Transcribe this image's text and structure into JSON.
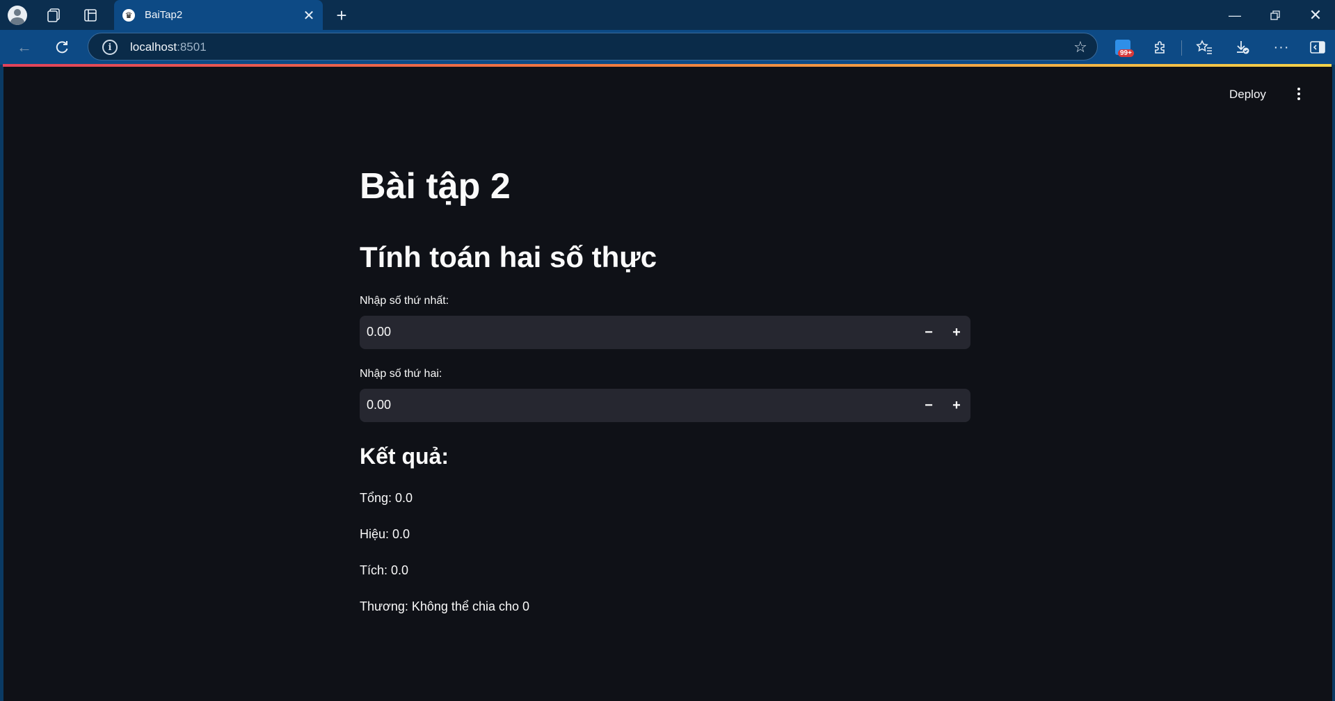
{
  "browser": {
    "tab_title": "BaiTap2",
    "url_host": "localhost",
    "url_port": ":8501",
    "extension_badge": "99+"
  },
  "app": {
    "deploy_label": "Deploy",
    "title": "Bài tập 2",
    "subheader": "Tính toán hai số thực",
    "input1": {
      "label": "Nhập số thứ nhất:",
      "value": "0.00"
    },
    "input2": {
      "label": "Nhập số thứ hai:",
      "value": "0.00"
    },
    "result_header": "Kết quả:",
    "results": {
      "sum": "Tổng: 0.0",
      "difference": "Hiệu: 0.0",
      "product": "Tích: 0.0",
      "quotient": "Thương: Không thể chia cho 0"
    }
  },
  "colors": {
    "page_background": "#0f1117",
    "input_background": "#262730",
    "text": "#fafafa",
    "browser_frame": "#0d4a85"
  },
  "icons": [
    "profile-icon",
    "collections-icon",
    "tab-actions-icon",
    "close-icon",
    "plus-icon",
    "minimize-icon",
    "restore-icon",
    "back-icon",
    "reload-icon",
    "info-icon",
    "star-icon",
    "extensions-icon",
    "favorites-icon",
    "downloads-icon",
    "more-icon",
    "sidebar-icon",
    "kebab-menu-icon",
    "minus-icon"
  ]
}
